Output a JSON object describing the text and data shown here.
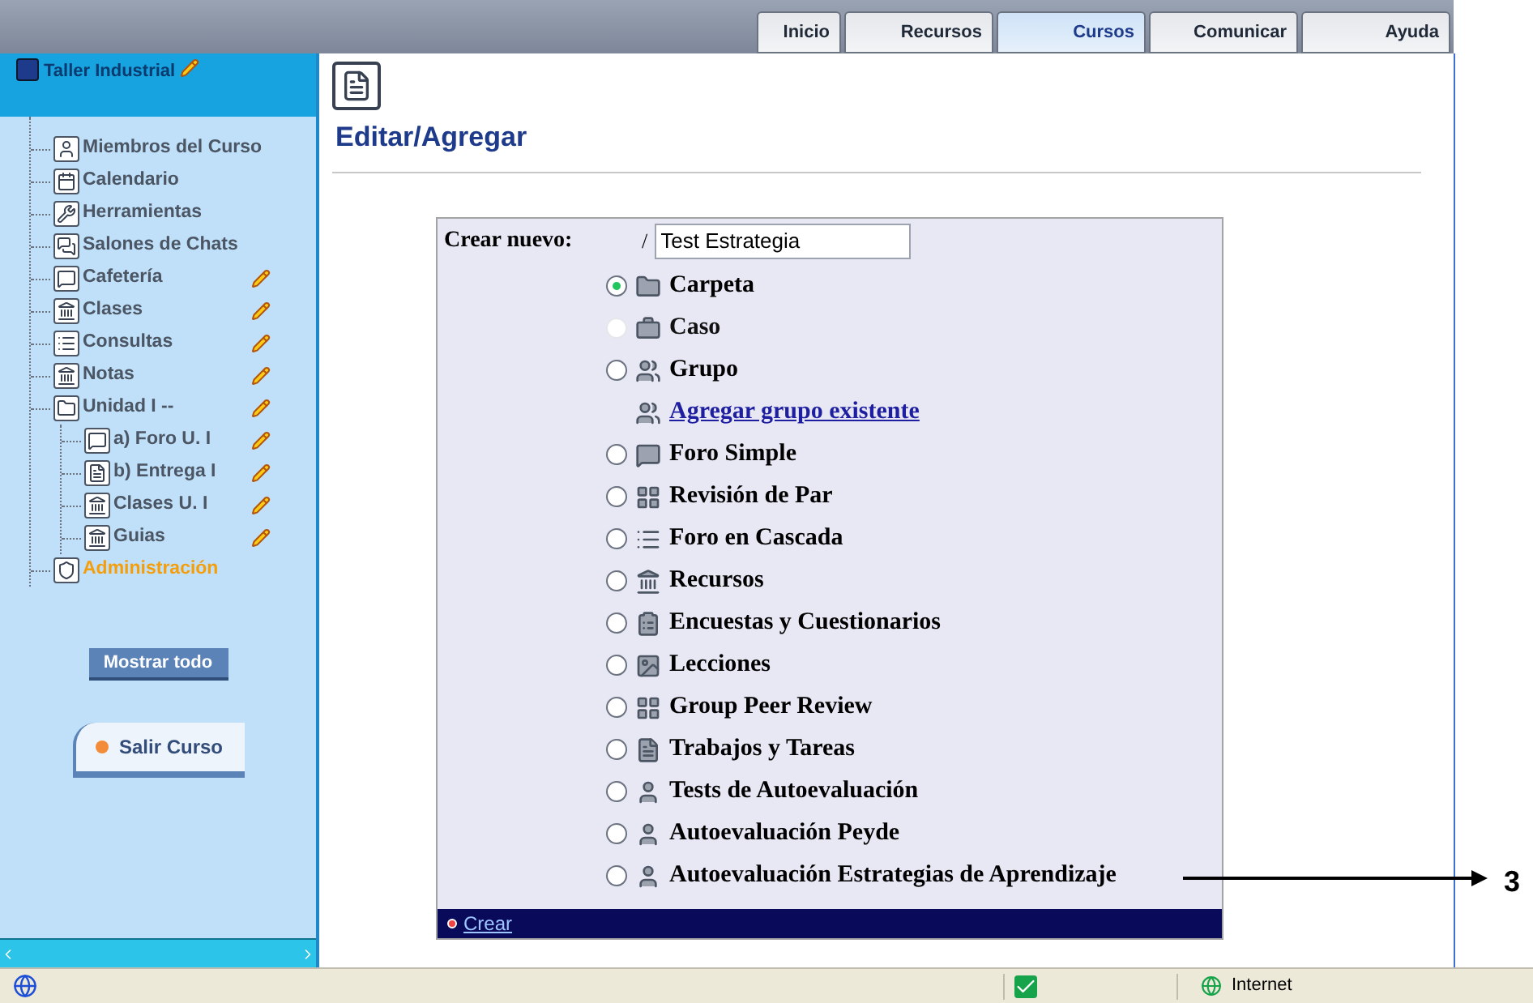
{
  "tabs": [
    {
      "label": "Inicio",
      "selected": false
    },
    {
      "label": "Recursos",
      "selected": false
    },
    {
      "label": "Cursos",
      "selected": true
    },
    {
      "label": "Comunicar",
      "selected": false
    },
    {
      "label": "Ayuda",
      "selected": false
    }
  ],
  "sidebar": {
    "title": "Taller Industrial",
    "items": [
      {
        "label": "Miembros del Curso",
        "editable": false,
        "highlighted": false
      },
      {
        "label": "Calendario",
        "editable": false,
        "highlighted": false
      },
      {
        "label": "Herramientas",
        "editable": false,
        "highlighted": false
      },
      {
        "label": "Salones de Chats",
        "editable": false,
        "highlighted": false
      },
      {
        "label": "Cafetería",
        "editable": true,
        "highlighted": false
      },
      {
        "label": "Clases",
        "editable": true,
        "highlighted": false
      },
      {
        "label": "Consultas",
        "editable": true,
        "highlighted": false
      },
      {
        "label": "Notas",
        "editable": true,
        "highlighted": false
      },
      {
        "label": "Unidad I --",
        "editable": true,
        "highlighted": false,
        "children": [
          {
            "label": "a) Foro U. I",
            "editable": true,
            "highlighted": false
          },
          {
            "label": "b) Entrega I",
            "editable": true,
            "highlighted": false
          },
          {
            "label": "Clases U. I",
            "editable": true,
            "highlighted": false
          },
          {
            "label": "Guias",
            "editable": true,
            "highlighted": false
          }
        ]
      },
      {
        "label": "Administración",
        "editable": false,
        "highlighted": true
      }
    ],
    "buttons": [
      "Mostrar todo",
      "Salir Curso"
    ]
  },
  "page": {
    "title": "Editar/Agregar",
    "form": {
      "label": "Crear nuevo:",
      "prefix": "/",
      "value": "Test Estrategia",
      "options": [
        {
          "kind": "radio",
          "label": "Carpeta",
          "selected": true,
          "disabled": false
        },
        {
          "kind": "radio",
          "label": "Caso",
          "selected": false,
          "disabled": true
        },
        {
          "kind": "radio",
          "label": "Grupo",
          "selected": false,
          "disabled": false
        },
        {
          "kind": "link",
          "label": "Agregar grupo existente"
        },
        {
          "kind": "radio",
          "label": "Foro Simple",
          "selected": false,
          "disabled": false
        },
        {
          "kind": "radio",
          "label": "Revisión de Par",
          "selected": false,
          "disabled": false
        },
        {
          "kind": "radio",
          "label": "Foro en Cascada",
          "selected": false,
          "disabled": false
        },
        {
          "kind": "radio",
          "label": "Recursos",
          "selected": false,
          "disabled": false
        },
        {
          "kind": "radio",
          "label": "Encuestas y Cuestionarios",
          "selected": false,
          "disabled": false
        },
        {
          "kind": "radio",
          "label": "Lecciones",
          "selected": false,
          "disabled": false
        },
        {
          "kind": "radio",
          "label": "Group Peer Review",
          "selected": false,
          "disabled": false
        },
        {
          "kind": "radio",
          "label": "Trabajos y Tareas",
          "selected": false,
          "disabled": false
        },
        {
          "kind": "radio",
          "label": "Tests de Autoevaluación",
          "selected": false,
          "disabled": false
        },
        {
          "kind": "radio",
          "label": "Autoevaluación Peyde",
          "selected": false,
          "disabled": false
        },
        {
          "kind": "radio",
          "label": "Autoevaluación Estrategias de Aprendizaje",
          "selected": false,
          "disabled": false
        }
      ],
      "submit": "Crear"
    }
  },
  "annotation": {
    "label": "3"
  },
  "status_bar": {
    "zone": "Internet"
  }
}
